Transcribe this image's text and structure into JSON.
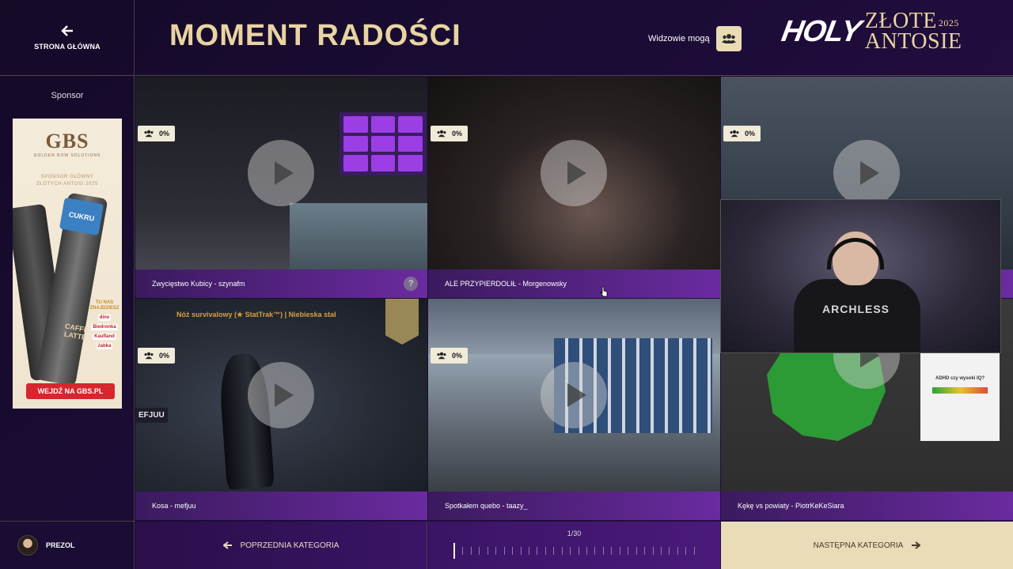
{
  "nav": {
    "home_label": "STRONA GŁÓWNA",
    "sponsor_label": "Sponsor"
  },
  "ad": {
    "brand": "GBS",
    "brand_sub": "GOLDEN BOW SOLUTIONS",
    "tagline_line1": "SPONSOR GŁÓWNY",
    "tagline_line2": "ZŁOTYCH ANTOSI 2025",
    "can_label_top": "CUKRU",
    "can_label_bottom": "CAFFE LATTE",
    "stores_header": "TU NAS ZNAJDZIESZ",
    "stores": [
      "dino",
      "Biedronka",
      "Kaufland",
      "żabka"
    ],
    "cta": "WEJDŹ NA GBS.PL"
  },
  "header": {
    "title": "MOMENT RADOŚCI",
    "viewers_label": "Widzowie mogą",
    "brand_holy": "HOLY",
    "brand_line1": "ZŁOTE",
    "brand_line2": "ANTOSIE",
    "brand_year": "2025"
  },
  "tiles": [
    {
      "title": "Zwycięstwo Kubicy - szynafm",
      "percent": "0%",
      "help": "?"
    },
    {
      "title": "ALE PRZYPIERDOLIŁ - Morgenowsky",
      "percent": "0%"
    },
    {
      "title": "",
      "percent": "0%"
    },
    {
      "title": "Kosa - mefjuu",
      "percent": "0%",
      "overlay_text": "Nóż survivalowy (★ StatTrak™) | Niebieska stal",
      "side_label": "EFJUU"
    },
    {
      "title": "Spotkałem quebo - taazy_",
      "percent": "0%"
    },
    {
      "title": "Kękę vs powiaty - PiotrKeKeSiara",
      "percent": "0%",
      "panel_text": "ADHD czy wysoki IQ?"
    }
  ],
  "webcam": {
    "shirt_text": "ARCHLESS"
  },
  "footer": {
    "user_name": "PREZOL",
    "prev_label": "POPRZEDNIA KATEGORIA",
    "progress_text": "1/30",
    "next_label": "NASTĘPNA KATEGORIA",
    "progress_current": 1,
    "progress_total": 30
  },
  "colors": {
    "gold": "#e8d4a2",
    "accent_purple": "#6a2ba0",
    "cream": "#e9dcb8"
  }
}
